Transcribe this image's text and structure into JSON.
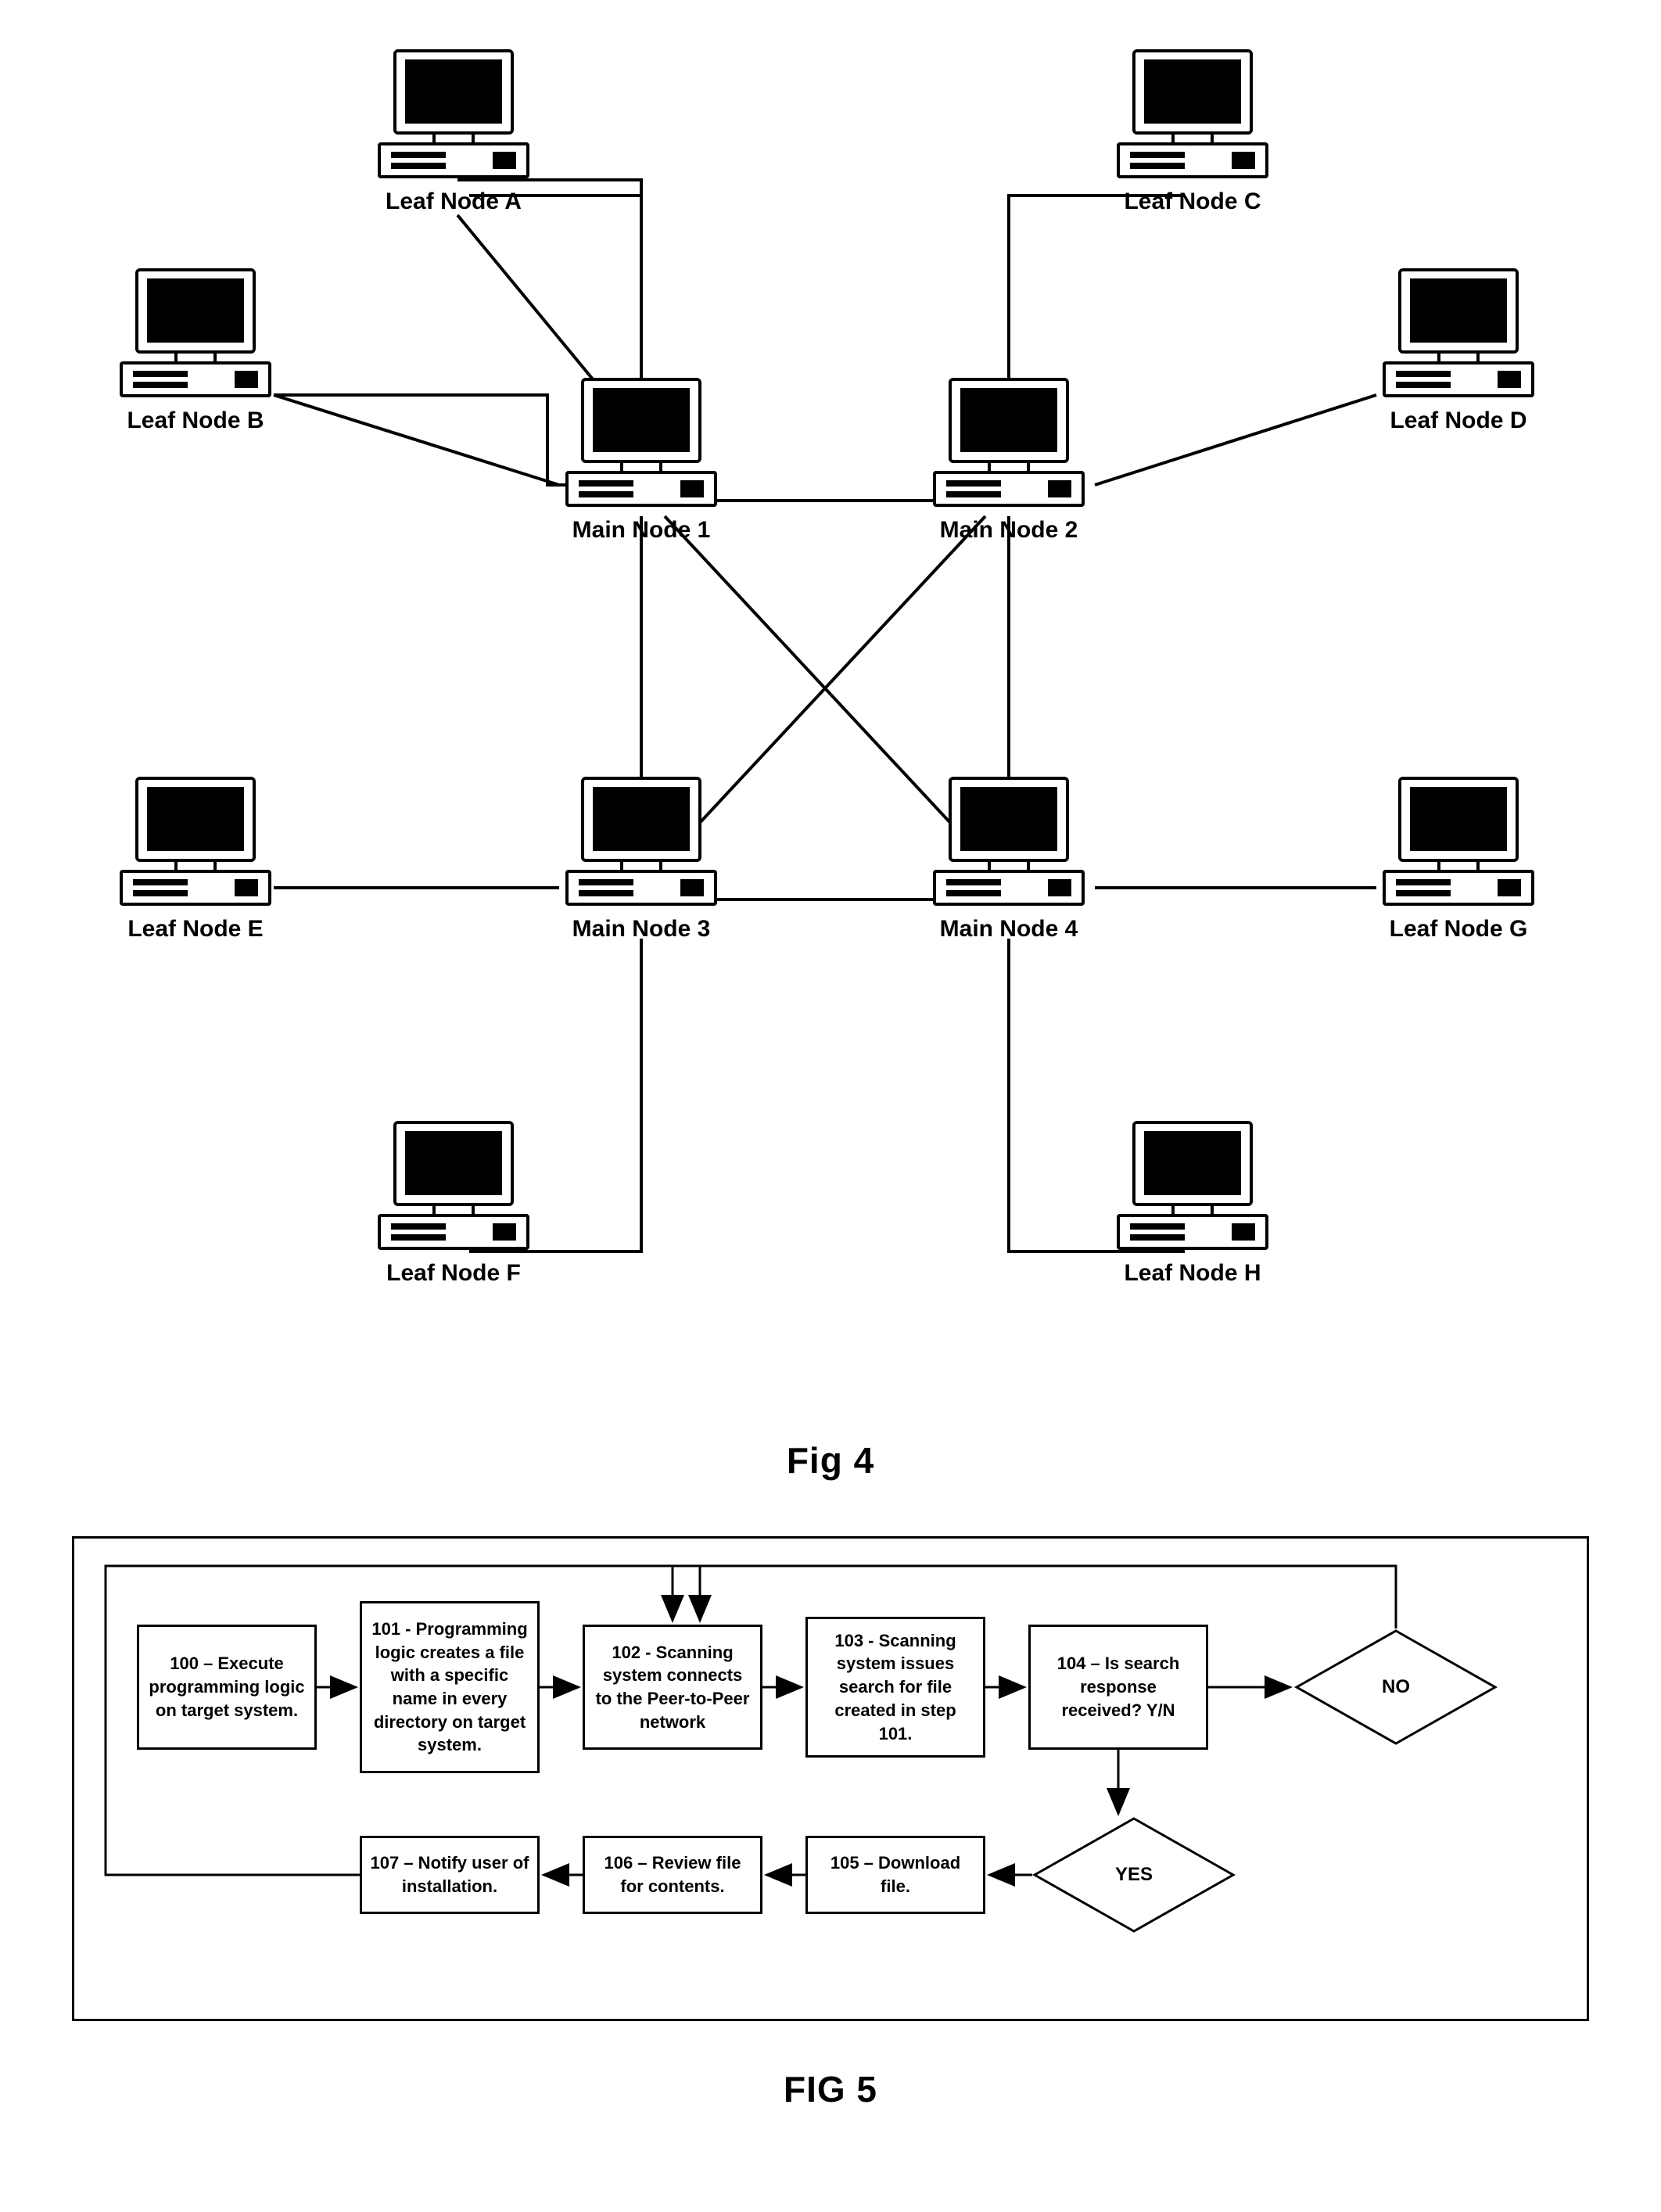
{
  "fig4_caption": "Fig 4",
  "fig5_caption": "FIG 5",
  "nodes": {
    "leafA": "Leaf Node A",
    "leafB": "Leaf Node B",
    "leafC": "Leaf Node C",
    "leafD": "Leaf Node D",
    "leafE": "Leaf Node E",
    "leafF": "Leaf Node F",
    "leafG": "Leaf Node G",
    "leafH": "Leaf Node H",
    "main1": "Main Node 1",
    "main2": "Main Node 2",
    "main3": "Main Node 3",
    "main4": "Main Node 4"
  },
  "flow": {
    "b100": "100 – Execute programming logic on target system.",
    "b101": "101 - Programming logic creates a file with a specific name in every directory on target system.",
    "b102": "102 - Scanning system connects to the Peer-to-Peer network",
    "b103": "103 - Scanning system issues search for file created in step 101.",
    "b104": "104 – Is search response received? Y/N",
    "b105": "105 – Download file.",
    "b106": "106 – Review file for contents.",
    "b107": "107 – Notify user of installation.",
    "no": "NO",
    "yes": "YES"
  },
  "network_edges": [
    [
      "leafA",
      "main1"
    ],
    [
      "leafB",
      "main1"
    ],
    [
      "leafC",
      "main2"
    ],
    [
      "leafD",
      "main2"
    ],
    [
      "leafE",
      "main3"
    ],
    [
      "leafF",
      "main3"
    ],
    [
      "leafG",
      "main4"
    ],
    [
      "leafH",
      "main4"
    ],
    [
      "main1",
      "main2"
    ],
    [
      "main1",
      "main3"
    ],
    [
      "main1",
      "main4"
    ],
    [
      "main2",
      "main3"
    ],
    [
      "main2",
      "main4"
    ],
    [
      "main3",
      "main4"
    ]
  ],
  "flow_sequence": [
    "b100",
    "b101",
    "b102",
    "b103",
    "b104",
    "decision_no_loops_to_b102",
    "decision_yes",
    "b105",
    "b106",
    "b107",
    "b107_loops_to_b102"
  ]
}
